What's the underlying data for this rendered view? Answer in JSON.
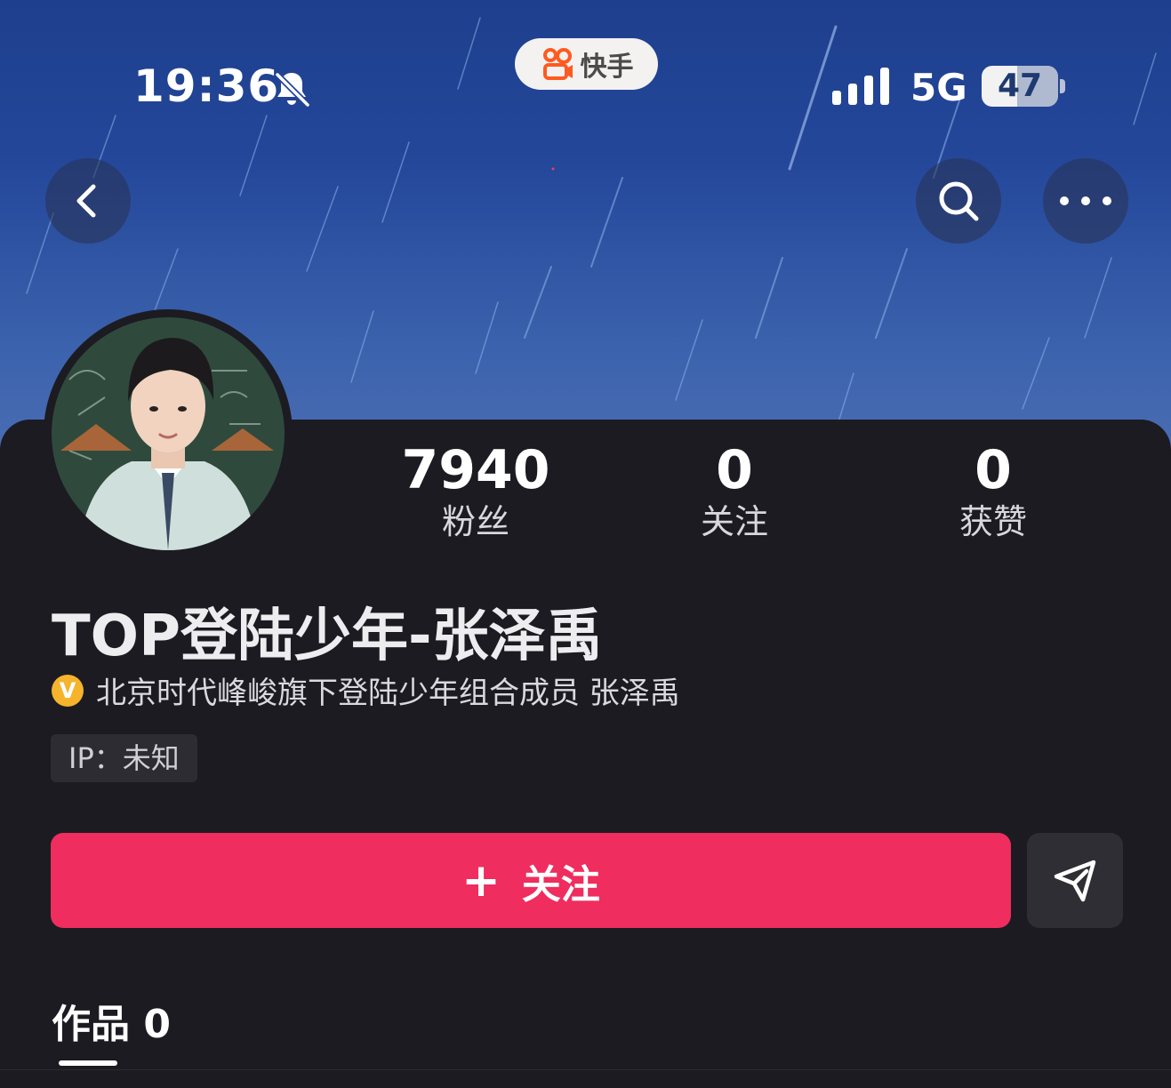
{
  "status_bar": {
    "time": "19:36",
    "network": "5G",
    "battery": "47",
    "battery_level": 0.47
  },
  "app_pill": {
    "label": "快手"
  },
  "profile": {
    "stats": [
      {
        "value": "7940",
        "label": "粉丝"
      },
      {
        "value": "0",
        "label": "关注"
      },
      {
        "value": "0",
        "label": "获赞"
      }
    ],
    "name": "TOP登陆少年-张泽禹",
    "verified_badge": "V",
    "verification": "北京时代峰峻旗下登陆少年组合成员 张泽禹",
    "ip": "IP：未知"
  },
  "actions": {
    "follow_plus": "+",
    "follow_label": "关注"
  },
  "tabs": [
    {
      "label": "作品 0"
    }
  ],
  "colors": {
    "accent": "#ef2d5e",
    "panel": "#1c1b21",
    "verified": "#f5b42c"
  }
}
